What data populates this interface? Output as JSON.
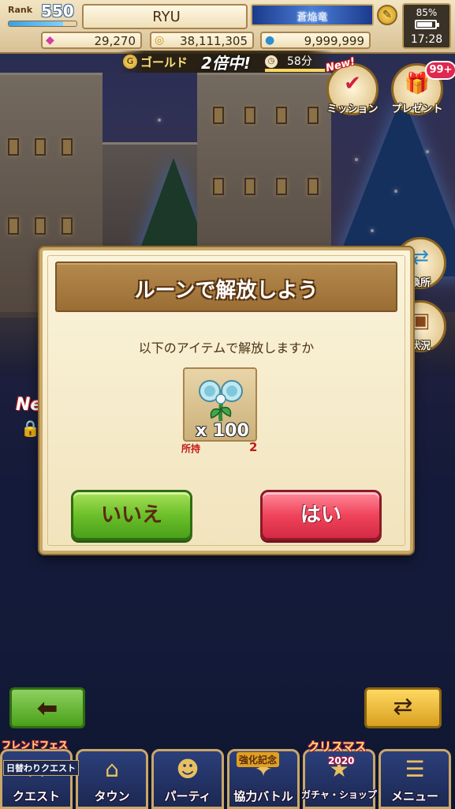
{
  "header": {
    "rank_label": "Rank",
    "rank_value": "550",
    "rank_progress": 0.8,
    "player_name": "RYU",
    "title_badge": "蒼焔竜",
    "currencies": {
      "gems": "29,270",
      "gold": "38,111,305",
      "stones": "9,999,999"
    },
    "battery_percent": "85%",
    "battery_level": 0.85,
    "clock": "17:28"
  },
  "gold_banner": {
    "label": "ゴールド",
    "multiplier": "2倍中!",
    "timer": "58分",
    "timer_progress": 0.95
  },
  "side_menu": {
    "mission_label": "ミッション",
    "mission_new_tag": "New!",
    "present_label": "プレゼント",
    "present_count": "99+",
    "exchange_label": "換所",
    "status_label": "状況"
  },
  "left_panel": {
    "new_tag": "Ne"
  },
  "dialog": {
    "title": "ルーンで解放しよう",
    "message": "以下のアイテムで解放しますか",
    "item_quantity": "x 100",
    "owned_label": "所持",
    "owned_count": "2",
    "no_label": "いいえ",
    "yes_label": "はい"
  },
  "bottom_nav": {
    "items": [
      {
        "label": "クエスト",
        "icon": "quest-icon"
      },
      {
        "label": "タウン",
        "icon": "town-icon"
      },
      {
        "label": "パーティ",
        "icon": "party-icon"
      },
      {
        "label": "協力バトル",
        "icon": "coop-battle-icon"
      },
      {
        "label": "ガチャ・ショップ",
        "icon": "gacha-shop-icon"
      },
      {
        "label": "メニュー",
        "icon": "menu-icon"
      }
    ],
    "event_tag": "フレンドフェス",
    "daily_tag": "日替わりクエスト",
    "enhance_tag": "強化記念",
    "christmas_tag": "クリスマス",
    "year_tag": "2020"
  },
  "colors": {
    "yes_button": "#f0445c",
    "no_button": "#6cc02a",
    "dialog_bg": "#fbf4dc",
    "dialog_header": "#a87a40"
  }
}
